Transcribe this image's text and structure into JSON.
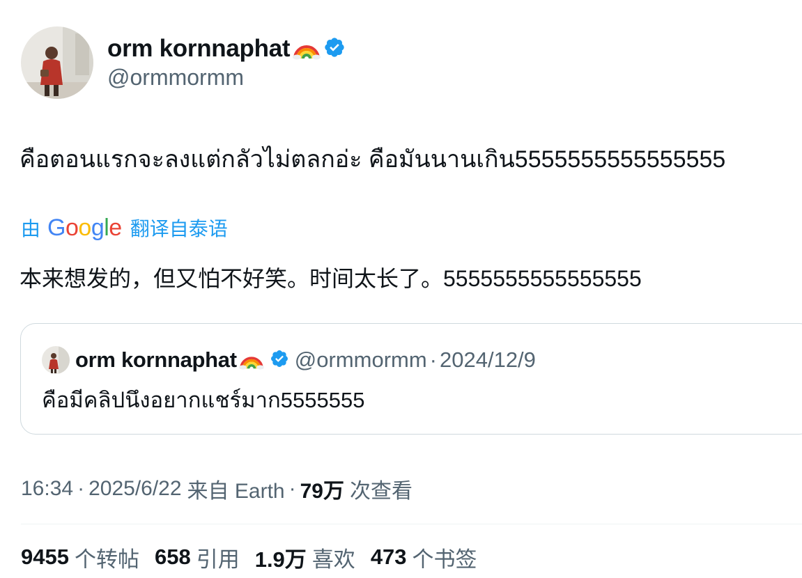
{
  "author": {
    "display_name": "orm kornnaphat",
    "handle": "@ormmormm",
    "badge_icon": "rainbow-emoji-icon",
    "verified_icon": "verified-badge-icon",
    "verified_color": "#1d9bf0"
  },
  "tweet": {
    "text": "คือตอนแรกจะลงแต่กลัวไม่ตลกอ่ะ คือมันนานเกิน5555555555555555",
    "translation": {
      "prefix": "由",
      "provider": "Google",
      "suffix": "翻译自泰语",
      "text": "本来想发的，但又怕不好笑。时间太长了。5555555555555555"
    }
  },
  "quote": {
    "display_name": "orm kornnaphat",
    "handle": "@ormmormm",
    "dot": "·",
    "date": "2024/12/9",
    "text": "คือมีคลิปนึงอยากแชร์มาก5555555"
  },
  "meta": {
    "time": "16:34",
    "sep": "·",
    "date": "2025/6/22",
    "source": "来自 Earth",
    "views_count": "79万",
    "views_label": "次查看"
  },
  "stats": [
    {
      "count": "9455",
      "label": "个转帖"
    },
    {
      "count": "658",
      "label": "引用"
    },
    {
      "count": "1.9万",
      "label": "喜欢"
    },
    {
      "count": "473",
      "label": "个书签"
    }
  ],
  "colors": {
    "text_primary": "#0f1419",
    "text_secondary": "#536471",
    "accent": "#1d9bf0",
    "border": "#cfd9de"
  }
}
